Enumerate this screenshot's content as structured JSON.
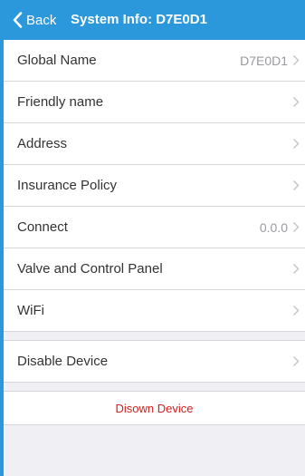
{
  "nav": {
    "back_label": "Back",
    "title": "System Info: D7E0D1"
  },
  "rows": [
    {
      "label": "Global Name",
      "value": "D7E0D1"
    },
    {
      "label": "Friendly name",
      "value": ""
    },
    {
      "label": "Address",
      "value": ""
    },
    {
      "label": "Insurance Policy",
      "value": ""
    },
    {
      "label": "Connect",
      "value": "0.0.0"
    },
    {
      "label": "Valve and Control Panel",
      "value": ""
    },
    {
      "label": "WiFi",
      "value": ""
    }
  ],
  "disable": {
    "label": "Disable Device"
  },
  "disown": {
    "label": "Disown Device"
  },
  "colors": {
    "accent": "#2b98dc",
    "destructive": "#d0201e",
    "background": "#efeff4"
  }
}
